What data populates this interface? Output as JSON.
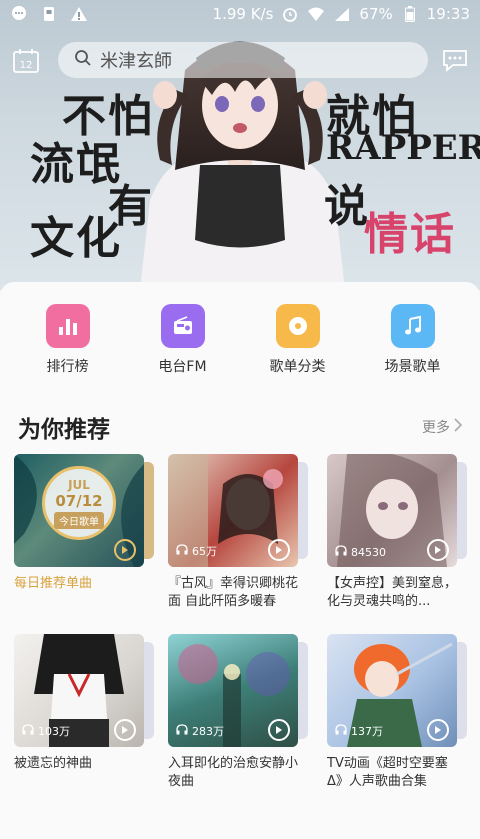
{
  "status_bar": {
    "speed": "1.99 K/s",
    "battery": "67%",
    "time": "19:33"
  },
  "topbar": {
    "search_placeholder": "米津玄師",
    "calendar_day": "12"
  },
  "banner": {
    "lines": [
      "不怕",
      "流氓",
      "有",
      "文化",
      "就怕",
      "RAPPER",
      "说",
      "情话"
    ]
  },
  "categories": [
    {
      "label": "排行榜",
      "icon": "chart-bars-icon",
      "color": "#f06fa0"
    },
    {
      "label": "电台FM",
      "icon": "radio-icon",
      "color": "#9a6cf0"
    },
    {
      "label": "歌单分类",
      "icon": "disc-icon",
      "color": "#f7b94a"
    },
    {
      "label": "场景歌单",
      "icon": "music-note-icon",
      "color": "#5bb8f5"
    }
  ],
  "recommend": {
    "title": "为你推荐",
    "more": "更多",
    "daily": {
      "month": "JUL",
      "date": "07/12",
      "tag": "今日歌单"
    },
    "items": [
      {
        "caption": "每日推荐单曲",
        "plays": ""
      },
      {
        "caption": "『古风』幸得识卿桃花面 自此阡陌多暖春",
        "plays": "65万"
      },
      {
        "caption": "【女声控】美到窒息，化与灵魂共鸣的...",
        "plays": "84530"
      },
      {
        "caption": "被遗忘的神曲",
        "plays": "103万"
      },
      {
        "caption": "入耳即化的治愈安静小夜曲",
        "plays": "283万"
      },
      {
        "caption": "TV动画《超时空要塞Δ》人声歌曲合集",
        "plays": "137万"
      }
    ]
  },
  "colors": {
    "accent": "#d8a23c"
  }
}
